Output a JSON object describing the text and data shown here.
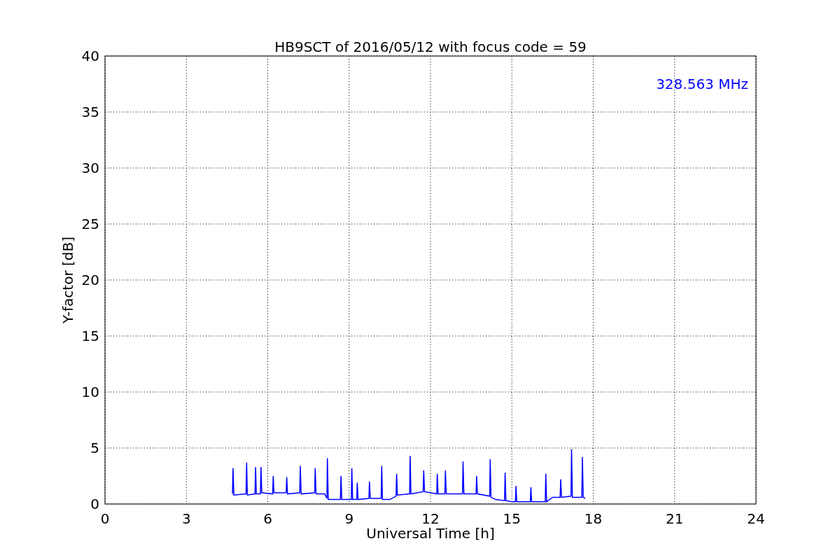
{
  "chart_data": {
    "type": "line",
    "title": "HB9SCT of 2016/05/12 with focus code = 59",
    "xlabel": "Universal Time [h]",
    "ylabel": "Y-factor [dB]",
    "xlim": [
      0,
      24
    ],
    "ylim": [
      0,
      40
    ],
    "xticks": [
      0,
      3,
      6,
      9,
      12,
      15,
      18,
      21,
      24
    ],
    "yticks": [
      0,
      5,
      10,
      15,
      20,
      25,
      30,
      35,
      40
    ],
    "annotations": [
      "328.563 MHz"
    ],
    "grid": true,
    "x": [
      4.7,
      4.72,
      4.75,
      5.2,
      5.22,
      5.25,
      5.53,
      5.55,
      5.58,
      5.73,
      5.75,
      5.78,
      6.18,
      6.2,
      6.23,
      6.68,
      6.7,
      6.73,
      7.18,
      7.2,
      7.23,
      7.73,
      7.75,
      7.78,
      8.1,
      8.18,
      8.2,
      8.23,
      8.68,
      8.7,
      8.73,
      9.08,
      9.1,
      9.13,
      9.28,
      9.3,
      9.33,
      9.73,
      9.75,
      9.78,
      10.18,
      10.2,
      10.23,
      10.5,
      10.73,
      10.75,
      10.78,
      11.23,
      11.25,
      11.28,
      11.73,
      11.75,
      11.78,
      12.23,
      12.25,
      12.28,
      12.53,
      12.55,
      12.58,
      13.18,
      13.2,
      13.23,
      13.68,
      13.7,
      13.73,
      14.18,
      14.2,
      14.23,
      14.4,
      14.73,
      14.75,
      14.78,
      15.0,
      15.13,
      15.15,
      15.18,
      15.68,
      15.7,
      15.73,
      16.23,
      16.25,
      16.28,
      16.5,
      16.78,
      16.8,
      16.83,
      17.18,
      17.2,
      17.23,
      17.58,
      17.6,
      17.63,
      17.7
    ],
    "series": [
      {
        "color": "#0000ff",
        "values": [
          0.9,
          3.2,
          0.8,
          0.9,
          3.7,
          0.8,
          0.9,
          3.3,
          0.9,
          0.9,
          3.3,
          1.0,
          0.9,
          2.5,
          1.0,
          1.0,
          2.4,
          0.9,
          1.0,
          3.4,
          0.9,
          1.0,
          3.2,
          0.9,
          0.9,
          0.5,
          4.1,
          0.4,
          0.4,
          2.5,
          0.4,
          0.4,
          3.2,
          0.4,
          0.4,
          1.9,
          0.4,
          0.5,
          2.0,
          0.5,
          0.5,
          3.4,
          0.4,
          0.4,
          0.7,
          2.7,
          0.8,
          0.9,
          4.3,
          0.9,
          1.1,
          3.0,
          1.1,
          0.9,
          2.7,
          0.9,
          0.9,
          3.0,
          0.9,
          0.9,
          3.8,
          0.9,
          0.9,
          2.5,
          0.9,
          0.7,
          4.0,
          0.6,
          0.4,
          0.3,
          2.8,
          0.3,
          0.2,
          0.2,
          1.6,
          0.2,
          0.2,
          1.5,
          0.2,
          0.2,
          2.7,
          0.2,
          0.6,
          0.6,
          2.2,
          0.6,
          0.7,
          4.9,
          0.6,
          0.6,
          4.2,
          0.6,
          0.5
        ]
      }
    ]
  }
}
